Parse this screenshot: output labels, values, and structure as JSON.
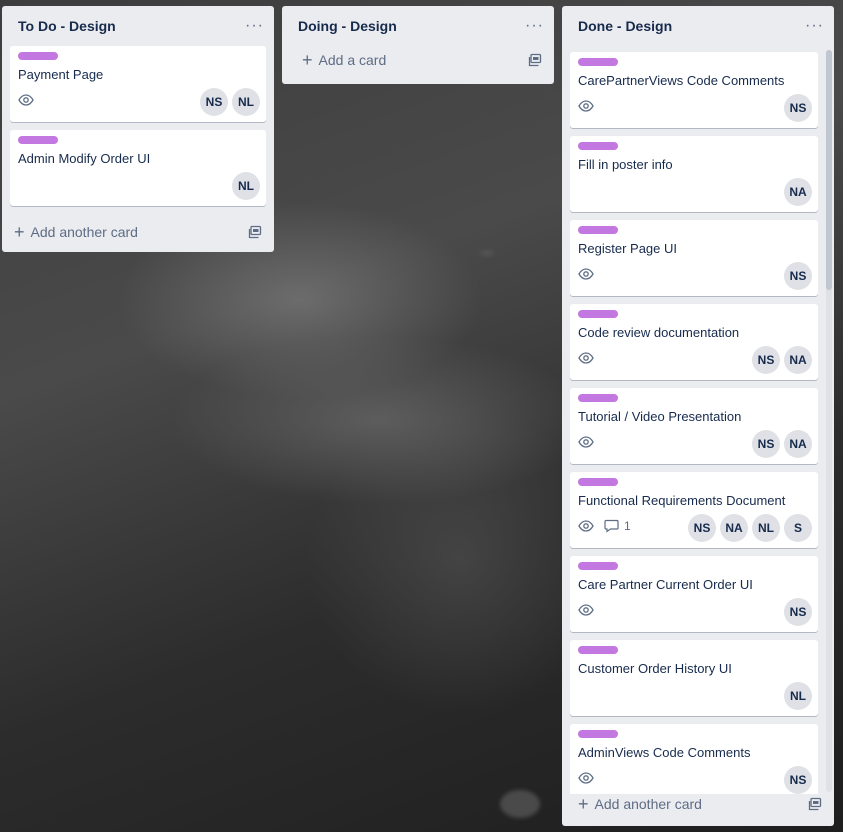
{
  "lists": [
    {
      "title": "To Do - Design",
      "menu": "···",
      "cards": [
        {
          "title": "Payment Page",
          "watch": true,
          "members": [
            "NS",
            "NL"
          ]
        },
        {
          "title": "Admin Modify Order UI",
          "watch": false,
          "members": [
            "NL"
          ]
        }
      ],
      "add_label": "Add another card"
    },
    {
      "title": "Doing - Design",
      "menu": "···",
      "cards": [],
      "add_label": "Add a card"
    },
    {
      "title": "Done - Design",
      "menu": "···",
      "cards": [
        {
          "title": "CarePartnerViews Code Comments",
          "watch": true,
          "members": [
            "NS"
          ]
        },
        {
          "title": "Fill in poster info",
          "watch": false,
          "members": [
            "NA"
          ]
        },
        {
          "title": "Register Page UI",
          "watch": true,
          "members": [
            "NS"
          ]
        },
        {
          "title": "Code review documentation",
          "watch": true,
          "members": [
            "NS",
            "NA"
          ]
        },
        {
          "title": "Tutorial / Video Presentation",
          "watch": true,
          "members": [
            "NS",
            "NA"
          ]
        },
        {
          "title": "Functional Requirements Document",
          "watch": true,
          "comments": "1",
          "members": [
            "NS",
            "NA",
            "NL",
            "S"
          ]
        },
        {
          "title": "Care Partner Current Order UI",
          "watch": true,
          "members": [
            "NS"
          ]
        },
        {
          "title": "Customer Order History UI",
          "watch": false,
          "members": [
            "NL"
          ]
        },
        {
          "title": "AdminViews Code Comments",
          "watch": true,
          "members": [
            "NS"
          ]
        }
      ],
      "add_label": "Add another card"
    }
  ],
  "colors": {
    "label": "#c377e0",
    "list_bg": "#ebecf0",
    "text": "#172b4d",
    "muted": "#5e6c84"
  },
  "icons": {
    "watch": "eye-icon",
    "comment": "comment-icon",
    "template": "card-template-icon",
    "add": "plus-icon",
    "menu": "more-horizontal-icon"
  }
}
